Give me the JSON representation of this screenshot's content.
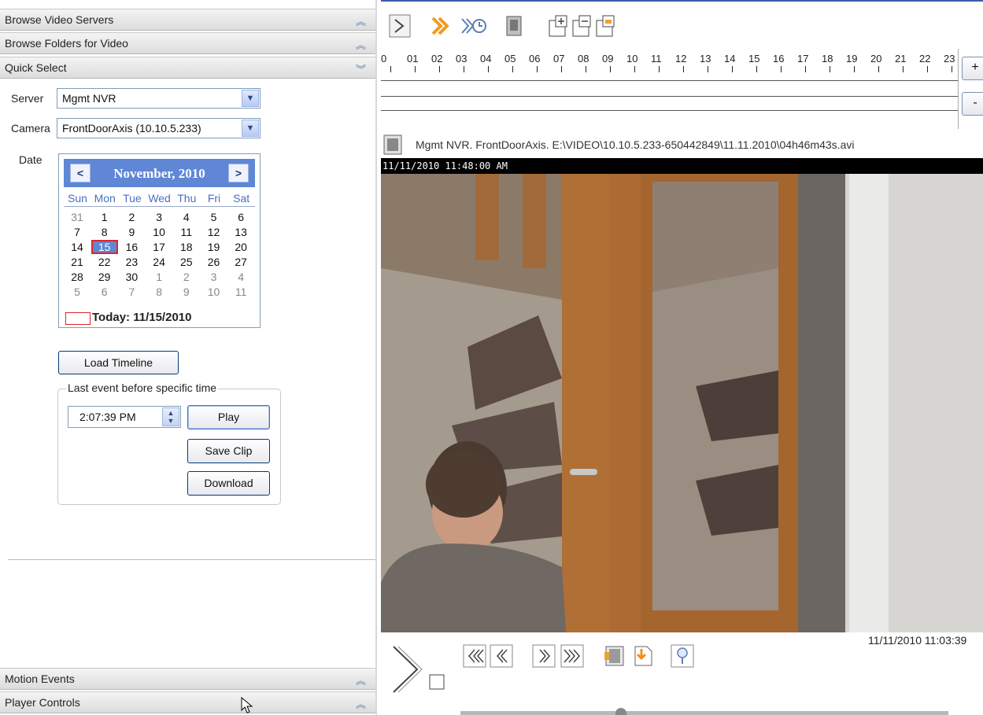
{
  "left_panel": {
    "sections": {
      "browse_servers": "Browse Video Servers",
      "browse_folders": "Browse Folders for Video",
      "quick_select": "Quick Select",
      "motion_events": "Motion Events",
      "player_controls": "Player Controls"
    },
    "server_label": "Server",
    "server_value": "Mgmt NVR",
    "camera_label": "Camera",
    "camera_value": "FrontDoorAxis (10.10.5.233)",
    "date_label": "Date",
    "calendar": {
      "title": "November, 2010",
      "prev": "<",
      "next": ">",
      "dow": [
        "Sun",
        "Mon",
        "Tue",
        "Wed",
        "Thu",
        "Fri",
        "Sat"
      ],
      "weeks": [
        [
          "31",
          "1",
          "2",
          "3",
          "4",
          "5",
          "6"
        ],
        [
          "7",
          "8",
          "9",
          "10",
          "11",
          "12",
          "13"
        ],
        [
          "14",
          "15",
          "16",
          "17",
          "18",
          "19",
          "20"
        ],
        [
          "21",
          "22",
          "23",
          "24",
          "25",
          "26",
          "27"
        ],
        [
          "28",
          "29",
          "30",
          "1",
          "2",
          "3",
          "4"
        ],
        [
          "5",
          "6",
          "7",
          "8",
          "9",
          "10",
          "11"
        ]
      ],
      "selected": "15",
      "today_text": "Today: 11/15/2010"
    },
    "load_timeline": "Load Timeline",
    "group_label": "Last event before specific time",
    "time_value": "2:07:39 PM",
    "play": "Play",
    "save_clip": "Save Clip",
    "download": "Download"
  },
  "timeline": {
    "hours": [
      "0",
      "01",
      "02",
      "03",
      "04",
      "05",
      "06",
      "07",
      "08",
      "09",
      "10",
      "11",
      "12",
      "13",
      "14",
      "15",
      "16",
      "17",
      "18",
      "19",
      "20",
      "21",
      "22",
      "23"
    ],
    "zoom_in": "+",
    "zoom_out": "-"
  },
  "video": {
    "title": "Mgmt NVR. FrontDoorAxis. E:\\VIDEO\\10.10.5.233-650442849\\11.11.2010\\04h46m43s.avi",
    "overlay_timestamp": "11/11/2010 11:48:00 AM",
    "end_timestamp": "11/11/2010 11:03:39"
  },
  "icons": {
    "toolbar": [
      "play-icon",
      "fast-play-icon",
      "play-timed-icon",
      "document-icon",
      "zoom-in-icon",
      "zoom-out-icon",
      "zoom-fit-icon"
    ],
    "controls": [
      "play-icon",
      "rewind-fast-icon",
      "step-back-icon",
      "step-forward-icon",
      "fast-forward-icon",
      "frames-icon",
      "export-icon",
      "magnify-icon"
    ]
  }
}
